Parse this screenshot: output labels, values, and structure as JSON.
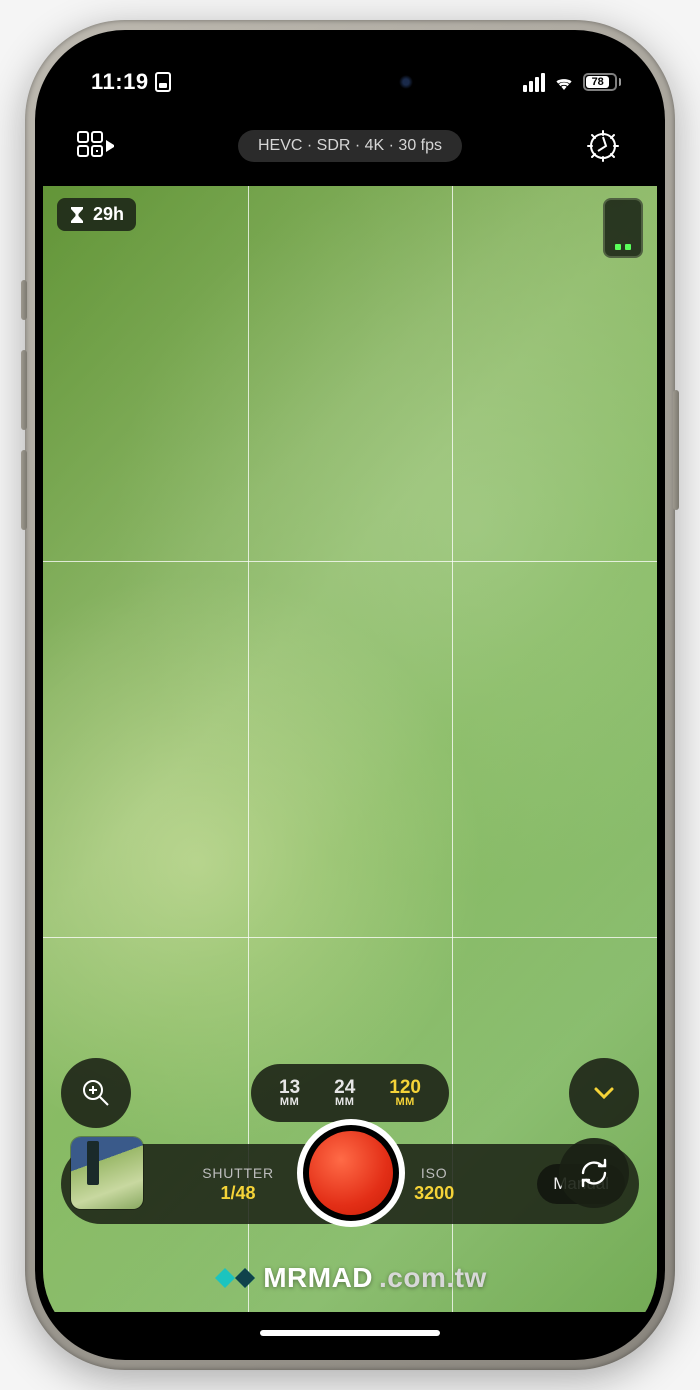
{
  "status": {
    "time": "11:19",
    "battery": "78"
  },
  "topbar": {
    "format": "HEVC · SDR · 4K · 30 fps"
  },
  "viewfinder": {
    "remaining": "29h"
  },
  "lenses": [
    {
      "value": "13",
      "unit": "MM",
      "active": false
    },
    {
      "value": "24",
      "unit": "MM",
      "active": false
    },
    {
      "value": "120",
      "unit": "MM",
      "active": true
    }
  ],
  "settings": {
    "shutter": {
      "label": "SHUTTER",
      "value": "1/48"
    },
    "iso": {
      "label": "ISO",
      "value": "3200"
    },
    "mode": "Manual"
  },
  "watermark": {
    "brand": "MRMAD",
    "domain": ".com.tw"
  },
  "colors": {
    "accent": "#f5d338",
    "record": "#e32f17"
  }
}
